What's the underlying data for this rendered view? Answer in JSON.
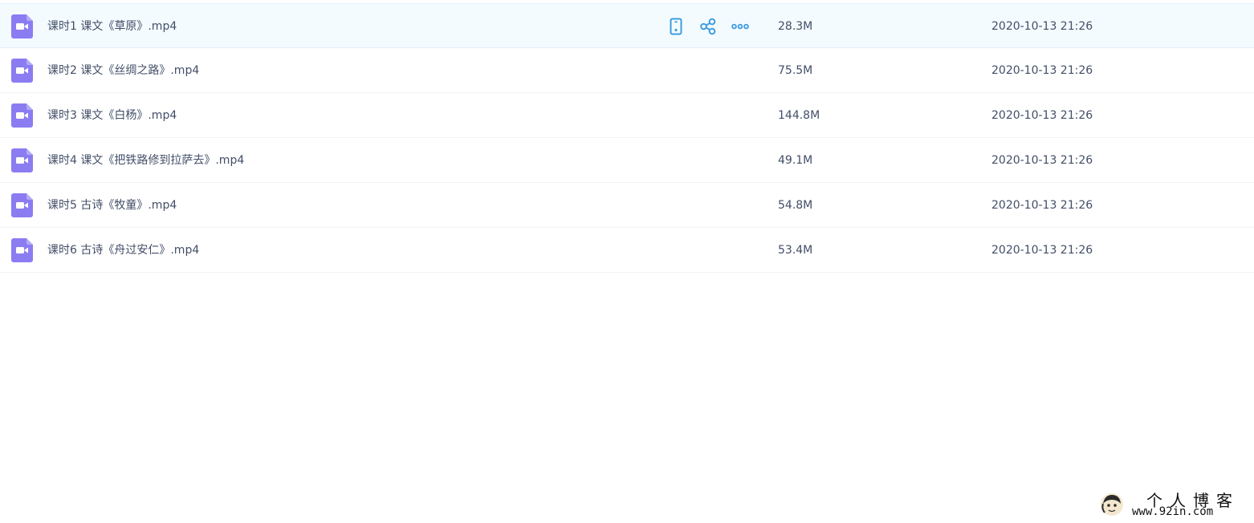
{
  "colors": {
    "accent": "#3d9de0",
    "video_icon": "#8b7cf2",
    "text": "#424e67",
    "row_hover": "#f4fbff"
  },
  "files": [
    {
      "name": "课时1 课文《草原》.mp4",
      "size": "28.3M",
      "date": "2020-10-13 21:26",
      "icon": "video-file-icon"
    },
    {
      "name": "课时2 课文《丝绸之路》.mp4",
      "size": "75.5M",
      "date": "2020-10-13 21:26",
      "icon": "video-file-icon"
    },
    {
      "name": "课时3 课文《白杨》.mp4",
      "size": "144.8M",
      "date": "2020-10-13 21:26",
      "icon": "video-file-icon"
    },
    {
      "name": "课时4 课文《把铁路修到拉萨去》.mp4",
      "size": "49.1M",
      "date": "2020-10-13 21:26",
      "icon": "video-file-icon"
    },
    {
      "name": "课时5 古诗《牧童》.mp4",
      "size": "54.8M",
      "date": "2020-10-13 21:26",
      "icon": "video-file-icon"
    },
    {
      "name": "课时6 古诗《舟过安仁》.mp4",
      "size": "53.4M",
      "date": "2020-10-13 21:26",
      "icon": "video-file-icon"
    }
  ],
  "row_actions": [
    "phone-icon",
    "share-icon",
    "more-icon"
  ],
  "watermark": {
    "title": "个人博客",
    "url": "www.92in.com"
  }
}
